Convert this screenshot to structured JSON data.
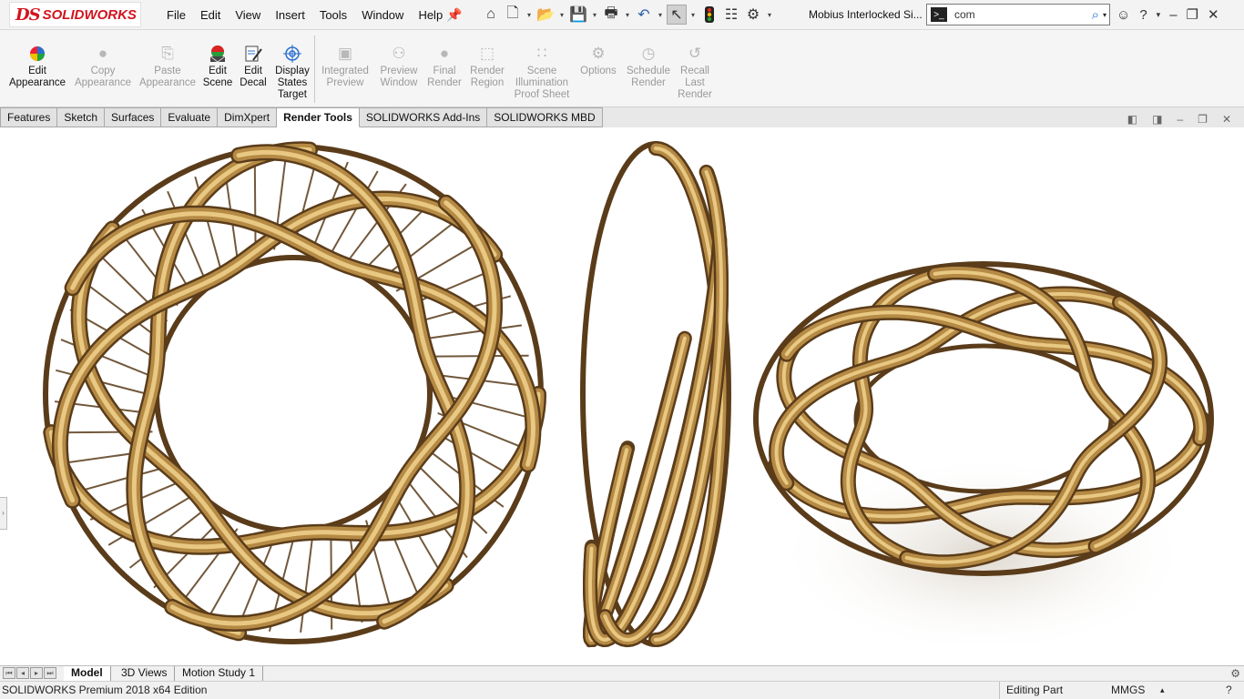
{
  "app": {
    "logo_prefix": "DS",
    "logo_name": "SOLIDWORKS",
    "document_title": "Mobius Interlocked Si..."
  },
  "menu": [
    "File",
    "Edit",
    "View",
    "Insert",
    "Tools",
    "Window",
    "Help"
  ],
  "search": {
    "value": "com"
  },
  "ribbon": {
    "buttons": [
      {
        "label": "Edit\nAppearance",
        "icon": "appearance-ball-icon",
        "enabled": true
      },
      {
        "label": "Copy\nAppearance",
        "icon": "copy-appearance-icon",
        "enabled": false
      },
      {
        "label": "Paste\nAppearance",
        "icon": "paste-appearance-icon",
        "enabled": false
      },
      {
        "label": "Edit\nScene",
        "icon": "scene-icon",
        "enabled": true
      },
      {
        "label": "Edit\nDecal",
        "icon": "decal-icon",
        "enabled": true
      },
      {
        "label": "Display\nStates\nTarget",
        "icon": "target-icon",
        "enabled": true
      },
      {
        "label": "Integrated\nPreview",
        "icon": "integrated-preview-icon",
        "enabled": false
      },
      {
        "label": "Preview\nWindow",
        "icon": "preview-window-icon",
        "enabled": false
      },
      {
        "label": "Final\nRender",
        "icon": "final-render-icon",
        "enabled": false
      },
      {
        "label": "Render\nRegion",
        "icon": "render-region-icon",
        "enabled": false
      },
      {
        "label": "Scene\nIllumination\nProof Sheet",
        "icon": "illumination-icon",
        "enabled": false
      },
      {
        "label": "Options",
        "icon": "options-icon",
        "enabled": false
      },
      {
        "label": "Schedule\nRender",
        "icon": "schedule-icon",
        "enabled": false
      },
      {
        "label": "Recall\nLast\nRender",
        "icon": "recall-icon",
        "enabled": false
      }
    ]
  },
  "tabs": [
    {
      "label": "Features",
      "active": false
    },
    {
      "label": "Sketch",
      "active": false
    },
    {
      "label": "Surfaces",
      "active": false
    },
    {
      "label": "Evaluate",
      "active": false
    },
    {
      "label": "DimXpert",
      "active": false
    },
    {
      "label": "Render Tools",
      "active": true
    },
    {
      "label": "SOLIDWORKS Add-Ins",
      "active": false
    },
    {
      "label": "SOLIDWORKS MBD",
      "active": false
    }
  ],
  "bottom_tabs": [
    {
      "label": "Model",
      "active": true
    },
    {
      "label": "3D Views",
      "active": false
    },
    {
      "label": "Motion Study 1",
      "active": false
    }
  ],
  "status": {
    "edition": "SOLIDWORKS Premium 2018 x64 Edition",
    "mode": "Editing Part",
    "units": "MMGS",
    "help": "?"
  },
  "colors": {
    "brand": "#d2141e",
    "gold_light": "#e8c882",
    "gold_mid": "#b58a45",
    "gold_dark": "#5a3c1a"
  }
}
